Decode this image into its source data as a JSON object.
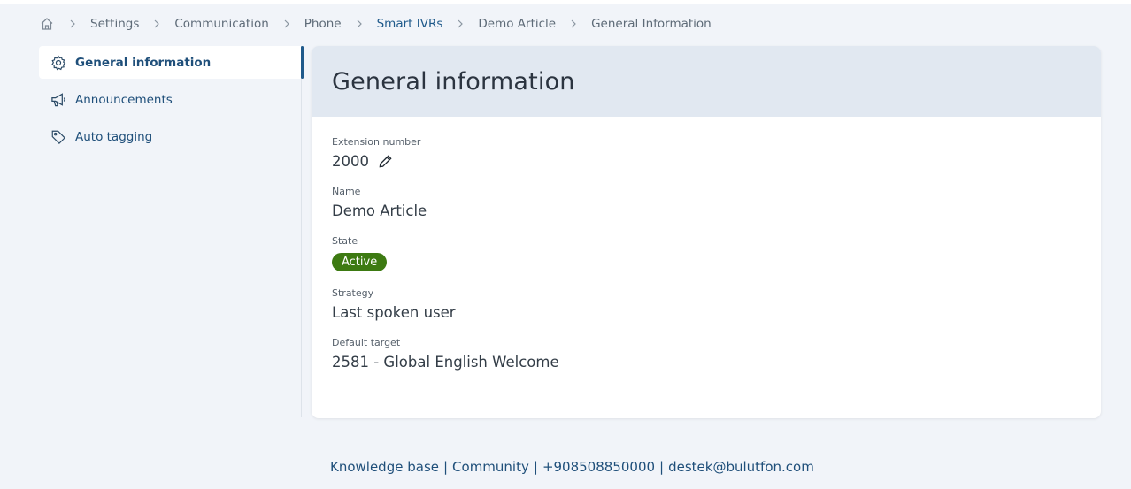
{
  "breadcrumb": {
    "items": [
      "Settings",
      "Communication",
      "Phone",
      "Smart IVRs",
      "Demo Article",
      "General Information"
    ]
  },
  "sidebar": {
    "items": [
      {
        "label": "General information",
        "icon": "gear-icon",
        "active": true
      },
      {
        "label": "Announcements",
        "icon": "megaphone-icon"
      },
      {
        "label": "Auto tagging",
        "icon": "tag-icon"
      }
    ]
  },
  "card": {
    "title": "General information",
    "fields": {
      "extension": {
        "label": "Extension number",
        "value": "2000"
      },
      "name": {
        "label": "Name",
        "value": "Demo Article"
      },
      "state": {
        "label": "State",
        "value": "Active",
        "color": "#3d7a12"
      },
      "strategy": {
        "label": "Strategy",
        "value": "Last spoken user"
      },
      "default_target": {
        "label": "Default target",
        "value": "2581 - Global English Welcome"
      }
    }
  },
  "footer": {
    "knowledge_base": "Knowledge base",
    "community": "Community",
    "phone": "+908508850000",
    "email": "destek@bulutfon.com"
  }
}
